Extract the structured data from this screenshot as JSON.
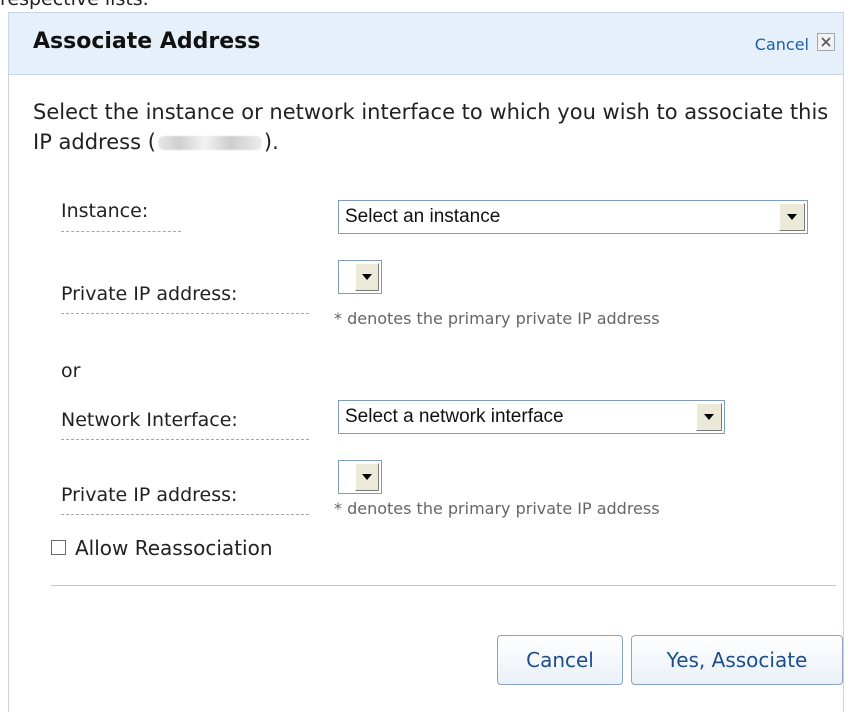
{
  "page": {
    "above_text": "respective lists."
  },
  "dialog": {
    "title": "Associate Address",
    "top_cancel_label": "Cancel",
    "description_part1": "Select the instance or network interface to which you wish to associate this IP address (",
    "description_part2": ").",
    "instance": {
      "label": "Instance:",
      "select_value": "Select an instance"
    },
    "instance_private_ip": {
      "label": "Private IP address:",
      "hint": "* denotes the primary private IP address"
    },
    "or_text": "or",
    "network_interface": {
      "label": "Network Interface:",
      "select_value": "Select a network interface"
    },
    "interface_private_ip": {
      "label": "Private IP address:",
      "hint": "* denotes the primary private IP address"
    },
    "allow_reassociation": {
      "label": "Allow Reassociation",
      "checked": false
    },
    "buttons": {
      "cancel_label": "Cancel",
      "associate_label": "Yes, Associate"
    }
  },
  "colors": {
    "title_bar_bg": "#e6f0fa",
    "link": "#1d5fa8",
    "button_text": "#1a4f8b",
    "border": "#c9d6e6"
  },
  "icons": {
    "close": "close-icon",
    "dropdown": "chevron-down-icon"
  }
}
